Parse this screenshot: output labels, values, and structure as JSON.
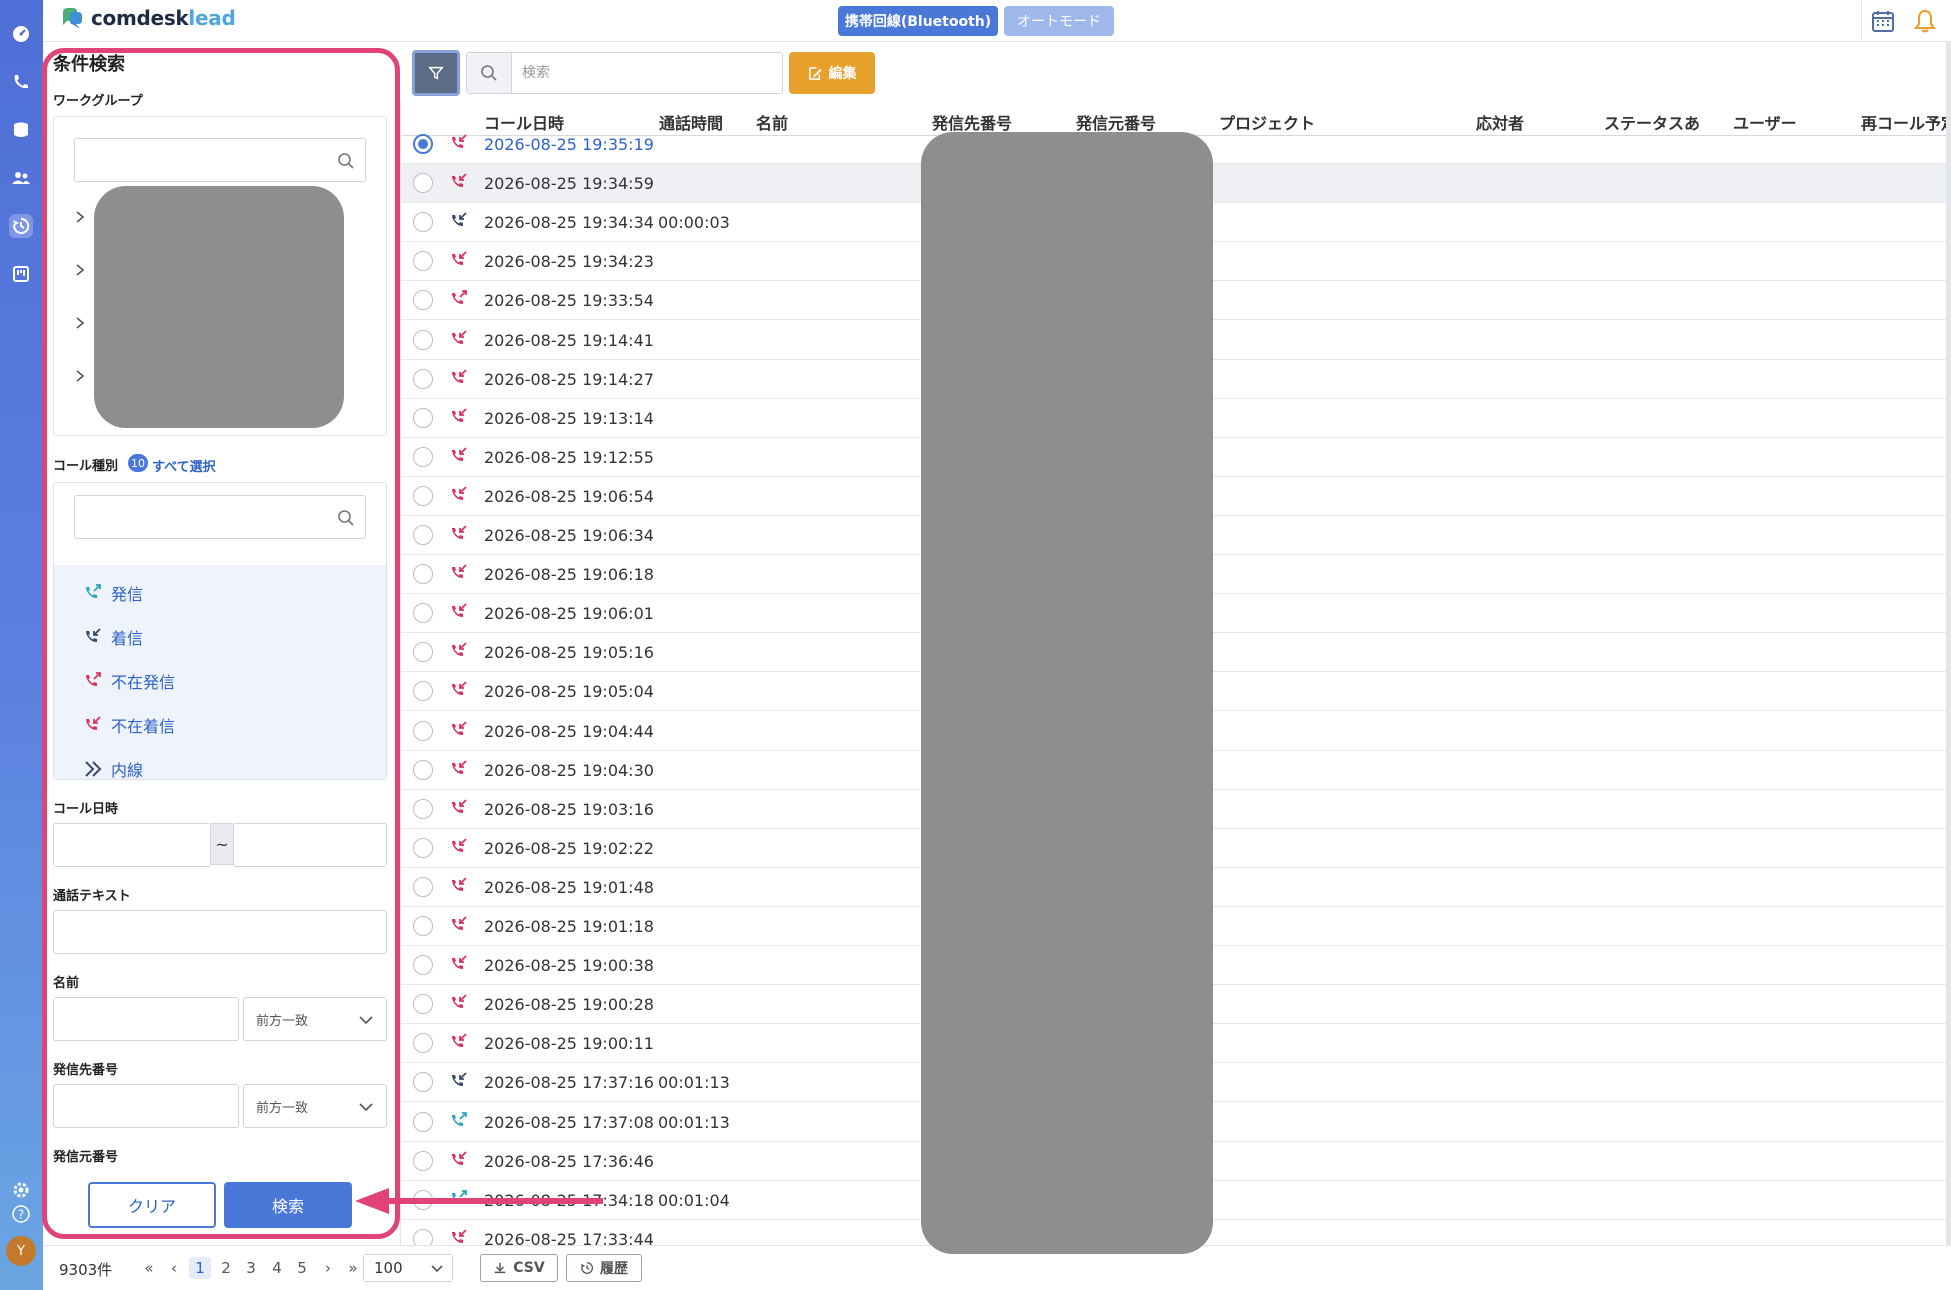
{
  "app": {
    "logo_main": "comdesk",
    "logo_accent": "lead",
    "bluetooth_button": "携帯回線(Bluetooth)",
    "auto_mode_button": "オートモード",
    "avatar_initial": "Y",
    "brand_color": "#4a78d8"
  },
  "sidebar_icons": [
    "dashboard-icon",
    "phone-icon",
    "database-icon",
    "users-icon",
    "history-icon",
    "board-icon",
    "settings-icon",
    "help-icon"
  ],
  "filter_panel": {
    "title": "条件検索",
    "workgroup_label": "ワークグループ",
    "calltype_label": "コール種別",
    "calltype_count": "10",
    "select_all": "すべて選択",
    "call_types": [
      {
        "label": "発信",
        "icon": "outgoing-call-icon",
        "color": "#2aa7b8"
      },
      {
        "label": "着信",
        "icon": "incoming-call-icon",
        "color": "#3a4a6a"
      },
      {
        "label": "不在発信",
        "icon": "missed-outgoing-icon",
        "color": "#d8345f"
      },
      {
        "label": "不在着信",
        "icon": "missed-incoming-icon",
        "color": "#d8345f"
      },
      {
        "label": "内線",
        "icon": "extension-icon",
        "color": "#3a4a6a"
      }
    ],
    "call_datetime_label": "コール日時",
    "range_separator": "~",
    "call_text_label": "通話テキスト",
    "name_label": "名前",
    "name_match": "前方一致",
    "dest_number_label": "発信先番号",
    "dest_match": "前方一致",
    "source_number_label": "発信元番号",
    "clear_button": "クリア",
    "search_button": "検索"
  },
  "toolbar": {
    "search_placeholder": "検索",
    "edit_button": "編集"
  },
  "table": {
    "columns": [
      "コール日時",
      "通話時間",
      "名前",
      "発信先番号",
      "発信元番号",
      "プロジェクト",
      "応対者",
      "ステータスあ",
      "ユーザー",
      "再コール予定"
    ],
    "rows": [
      {
        "type": "missed-in",
        "datetime": "2026-08-25 19:35:19",
        "duration": "",
        "selected": true
      },
      {
        "type": "missed-in",
        "datetime": "2026-08-25 19:34:59",
        "duration": "",
        "highlight": true
      },
      {
        "type": "in",
        "datetime": "2026-08-25 19:34:34",
        "duration": "00:00:03"
      },
      {
        "type": "missed-in",
        "datetime": "2026-08-25 19:34:23",
        "duration": ""
      },
      {
        "type": "missed-out",
        "datetime": "2026-08-25 19:33:54",
        "duration": ""
      },
      {
        "type": "missed-in",
        "datetime": "2026-08-25 19:14:41",
        "duration": ""
      },
      {
        "type": "missed-in",
        "datetime": "2026-08-25 19:14:27",
        "duration": ""
      },
      {
        "type": "missed-in",
        "datetime": "2026-08-25 19:13:14",
        "duration": ""
      },
      {
        "type": "missed-in",
        "datetime": "2026-08-25 19:12:55",
        "duration": ""
      },
      {
        "type": "missed-in",
        "datetime": "2026-08-25 19:06:54",
        "duration": ""
      },
      {
        "type": "missed-in",
        "datetime": "2026-08-25 19:06:34",
        "duration": ""
      },
      {
        "type": "missed-in",
        "datetime": "2026-08-25 19:06:18",
        "duration": ""
      },
      {
        "type": "missed-in",
        "datetime": "2026-08-25 19:06:01",
        "duration": ""
      },
      {
        "type": "missed-in",
        "datetime": "2026-08-25 19:05:16",
        "duration": ""
      },
      {
        "type": "missed-in",
        "datetime": "2026-08-25 19:05:04",
        "duration": ""
      },
      {
        "type": "missed-in",
        "datetime": "2026-08-25 19:04:44",
        "duration": ""
      },
      {
        "type": "missed-in",
        "datetime": "2026-08-25 19:04:30",
        "duration": ""
      },
      {
        "type": "missed-in",
        "datetime": "2026-08-25 19:03:16",
        "duration": ""
      },
      {
        "type": "missed-in",
        "datetime": "2026-08-25 19:02:22",
        "duration": ""
      },
      {
        "type": "missed-in",
        "datetime": "2026-08-25 19:01:48",
        "duration": ""
      },
      {
        "type": "missed-in",
        "datetime": "2026-08-25 19:01:18",
        "duration": ""
      },
      {
        "type": "missed-in",
        "datetime": "2026-08-25 19:00:38",
        "duration": ""
      },
      {
        "type": "missed-in",
        "datetime": "2026-08-25 19:00:28",
        "duration": ""
      },
      {
        "type": "missed-in",
        "datetime": "2026-08-25 19:00:11",
        "duration": ""
      },
      {
        "type": "in",
        "datetime": "2026-08-25 17:37:16",
        "duration": "00:01:13"
      },
      {
        "type": "out",
        "datetime": "2026-08-25 17:37:08",
        "duration": "00:01:13"
      },
      {
        "type": "missed-in",
        "datetime": "2026-08-25 17:36:46",
        "duration": ""
      },
      {
        "type": "out",
        "datetime": "2026-08-25 17:34:18",
        "duration": "00:01:04"
      },
      {
        "type": "missed-in",
        "datetime": "2026-08-25 17:33:44",
        "duration": ""
      }
    ]
  },
  "footer": {
    "total_count": "9303件",
    "first": "«",
    "prev": "‹",
    "pages": [
      "1",
      "2",
      "3",
      "4",
      "5"
    ],
    "next": "›",
    "last": "»",
    "page_size": "100",
    "csv_button": "CSV",
    "history_button": "履歴"
  }
}
